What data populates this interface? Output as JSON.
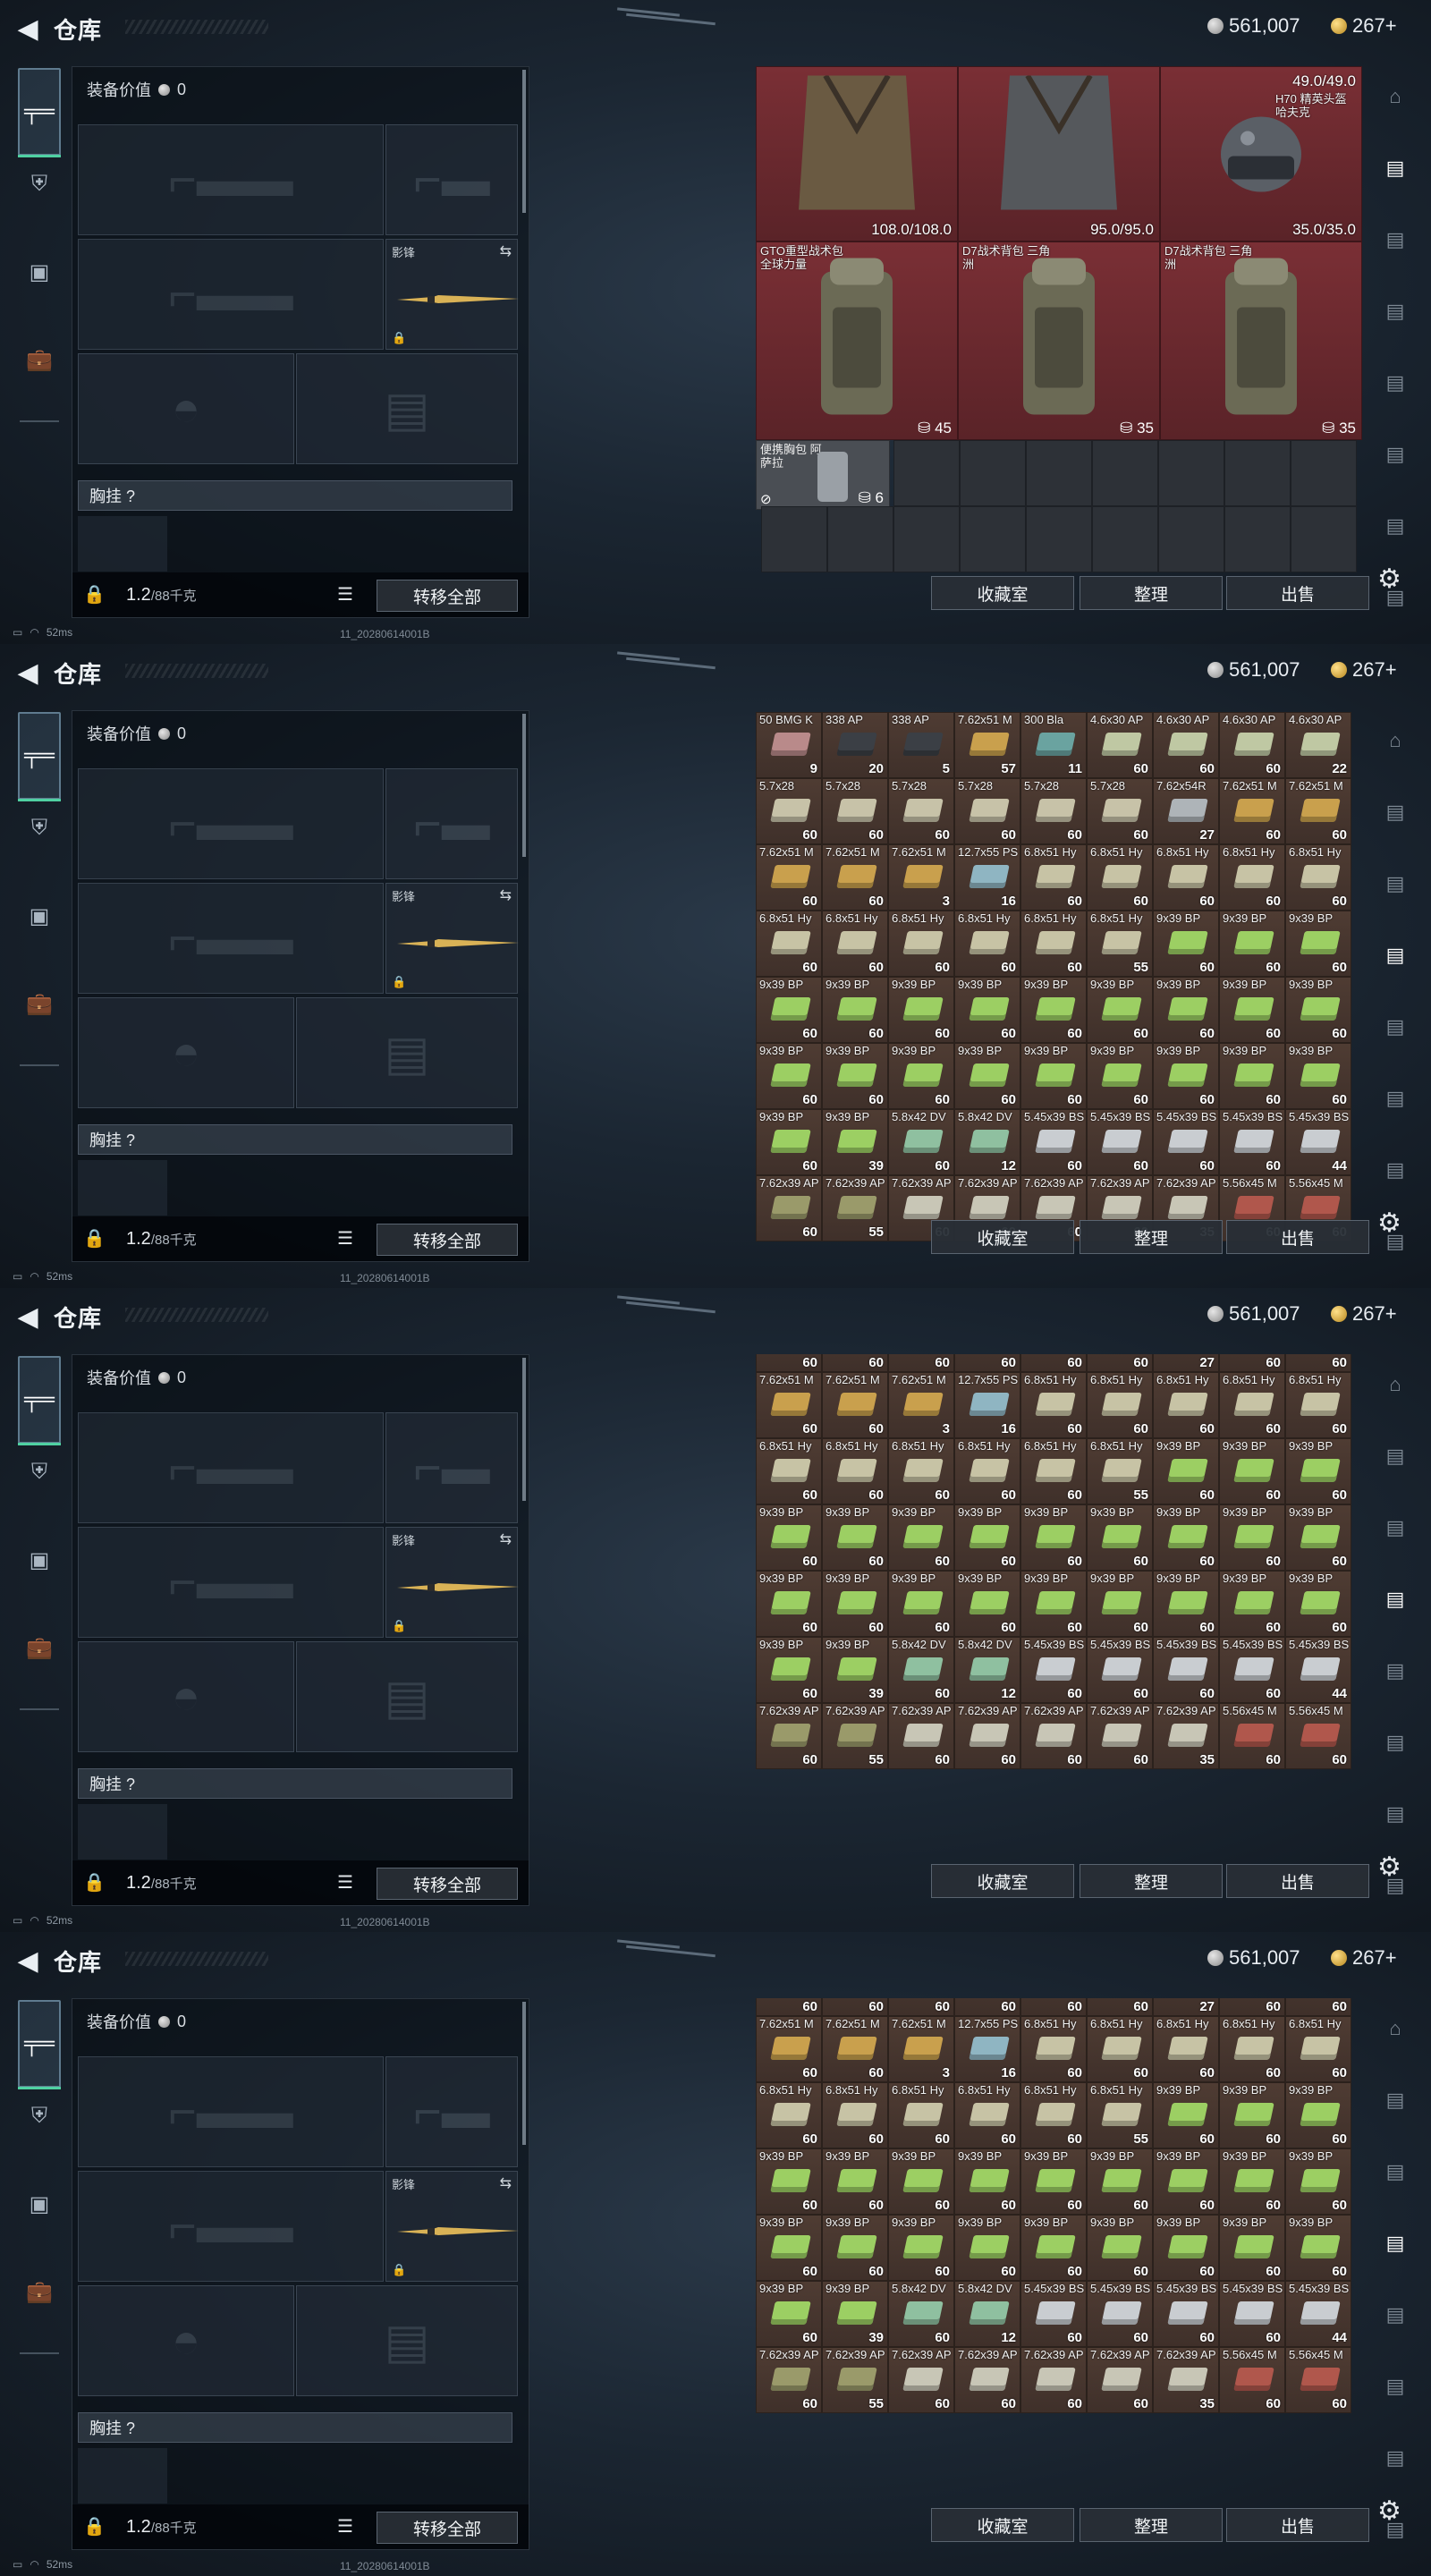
{
  "app": {
    "title": "仓库",
    "currency_silver": "561,007",
    "currency_gold": "267+",
    "back_icon": "back-arrow-icon"
  },
  "equipment": {
    "value_label": "装备价值",
    "value": "0",
    "knife_label": "影锋",
    "chest_label": "胸挂 ?",
    "weight": "1.2",
    "weight_unit": "/88千克",
    "transfer_all": "转移全部"
  },
  "status": {
    "ping": "52ms",
    "session": "11_20280614001B"
  },
  "stash_buttons": {
    "collection": "收藏室",
    "sort": "整理",
    "sell": "出售"
  },
  "panel1": {
    "vests": [
      {
        "name": "",
        "durability": "108.0/108.0"
      },
      {
        "name": "",
        "durability": "95.0/95.0"
      },
      {
        "name": "H70 精英头盔 哈夫克",
        "durability": "35.0/35.0",
        "top": "49.0/49.0"
      }
    ],
    "backpacks": [
      {
        "name": "GTO重型战术包 全球力量",
        "capacity": "45"
      },
      {
        "name": "D7战术背包 三角洲",
        "capacity": "35"
      },
      {
        "name": "D7战术背包 三角洲",
        "capacity": "35"
      }
    ],
    "chestrig": {
      "name": "便携胸包 阿萨拉",
      "capacity": "6"
    }
  },
  "ammo_rows": [
    [
      [
        "50 BMG K",
        "9",
        "#b98a8a"
      ],
      [
        "338 AP",
        "20",
        "#3b3f45"
      ],
      [
        "338 AP",
        "5",
        "#3b3f45"
      ],
      [
        "7.62x51 M",
        "57",
        "#c9a04d"
      ],
      [
        "300 Bla",
        "11",
        "#6aa3a0"
      ],
      [
        "4.6x30 AP",
        "60",
        "#bfc8a3"
      ],
      [
        "4.6x30 AP",
        "60",
        "#bfc8a3"
      ],
      [
        "4.6x30 AP",
        "60",
        "#bfc8a3"
      ],
      [
        "4.6x30 AP",
        "22",
        "#bfc8a3"
      ]
    ],
    [
      [
        "5.7x28",
        "60",
        "#c7c2a8"
      ],
      [
        "5.7x28",
        "60",
        "#c7c2a8"
      ],
      [
        "5.7x28",
        "60",
        "#c7c2a8"
      ],
      [
        "5.7x28",
        "60",
        "#c7c2a8"
      ],
      [
        "5.7x28",
        "60",
        "#c7c2a8"
      ],
      [
        "5.7x28",
        "60",
        "#c7c2a8"
      ],
      [
        "7.62x54R",
        "27",
        "#aeb4b8"
      ],
      [
        "7.62x51 M",
        "60",
        "#c9a04d"
      ],
      [
        "7.62x51 M",
        "60",
        "#c9a04d"
      ]
    ],
    [
      [
        "7.62x51 M",
        "60",
        "#c9a04d"
      ],
      [
        "7.62x51 M",
        "60",
        "#c9a04d"
      ],
      [
        "7.62x51 M",
        "3",
        "#c9a04d"
      ],
      [
        "12.7x55 PS",
        "16",
        "#8fb5c2"
      ],
      [
        "6.8x51 Hy",
        "60",
        "#c7c3a5"
      ],
      [
        "6.8x51 Hy",
        "60",
        "#c7c3a5"
      ],
      [
        "6.8x51 Hy",
        "60",
        "#c7c3a5"
      ],
      [
        "6.8x51 Hy",
        "60",
        "#c7c3a5"
      ],
      [
        "6.8x51 Hy",
        "60",
        "#c7c3a5"
      ]
    ],
    [
      [
        "6.8x51 Hy",
        "60",
        "#c7c3a5"
      ],
      [
        "6.8x51 Hy",
        "60",
        "#c7c3a5"
      ],
      [
        "6.8x51 Hy",
        "60",
        "#c7c3a5"
      ],
      [
        "6.8x51 Hy",
        "60",
        "#c7c3a5"
      ],
      [
        "6.8x51 Hy",
        "60",
        "#c7c3a5"
      ],
      [
        "6.8x51 Hy",
        "55",
        "#c7c3a5"
      ],
      [
        "9x39 BP",
        "60",
        "#9ccf63"
      ],
      [
        "9x39 BP",
        "60",
        "#9ccf63"
      ],
      [
        "9x39 BP",
        "60",
        "#9ccf63"
      ]
    ],
    [
      [
        "9x39 BP",
        "60",
        "#9ccf63"
      ],
      [
        "9x39 BP",
        "60",
        "#9ccf63"
      ],
      [
        "9x39 BP",
        "60",
        "#9ccf63"
      ],
      [
        "9x39 BP",
        "60",
        "#9ccf63"
      ],
      [
        "9x39 BP",
        "60",
        "#9ccf63"
      ],
      [
        "9x39 BP",
        "60",
        "#9ccf63"
      ],
      [
        "9x39 BP",
        "60",
        "#9ccf63"
      ],
      [
        "9x39 BP",
        "60",
        "#9ccf63"
      ],
      [
        "9x39 BP",
        "60",
        "#9ccf63"
      ]
    ],
    [
      [
        "9x39 BP",
        "60",
        "#9ccf63"
      ],
      [
        "9x39 BP",
        "60",
        "#9ccf63"
      ],
      [
        "9x39 BP",
        "60",
        "#9ccf63"
      ],
      [
        "9x39 BP",
        "60",
        "#9ccf63"
      ],
      [
        "9x39 BP",
        "60",
        "#9ccf63"
      ],
      [
        "9x39 BP",
        "60",
        "#9ccf63"
      ],
      [
        "9x39 BP",
        "60",
        "#9ccf63"
      ],
      [
        "9x39 BP",
        "60",
        "#9ccf63"
      ],
      [
        "9x39 BP",
        "60",
        "#9ccf63"
      ]
    ],
    [
      [
        "9x39 BP",
        "60",
        "#9ccf63"
      ],
      [
        "9x39 BP",
        "39",
        "#9ccf63"
      ],
      [
        "5.8x42 DV",
        "60",
        "#8fc0a0"
      ],
      [
        "5.8x42 DV",
        "12",
        "#8fc0a0"
      ],
      [
        "5.45x39 BS",
        "60",
        "#c9cdd1"
      ],
      [
        "5.45x39 BS",
        "60",
        "#c9cdd1"
      ],
      [
        "5.45x39 BS",
        "60",
        "#c9cdd1"
      ],
      [
        "5.45x39 BS",
        "60",
        "#c9cdd1"
      ],
      [
        "5.45x39 BS",
        "44",
        "#c9cdd1"
      ]
    ],
    [
      [
        "7.62x39 AP",
        "60",
        "#9a9a6a"
      ],
      [
        "7.62x39 AP",
        "55",
        "#9a9a6a"
      ],
      [
        "7.62x39 AP",
        "60",
        "#c8c6b6"
      ],
      [
        "7.62x39 AP",
        "60",
        "#c8c6b6"
      ],
      [
        "7.62x39 AP",
        "60",
        "#c8c6b6"
      ],
      [
        "7.62x39 AP",
        "60",
        "#c8c6b6"
      ],
      [
        "7.62x39 AP",
        "35",
        "#c8c6b6"
      ],
      [
        "5.56x45 M",
        "60",
        "#b0574c"
      ],
      [
        "5.56x45 M",
        "60",
        "#b0574c"
      ]
    ]
  ]
}
